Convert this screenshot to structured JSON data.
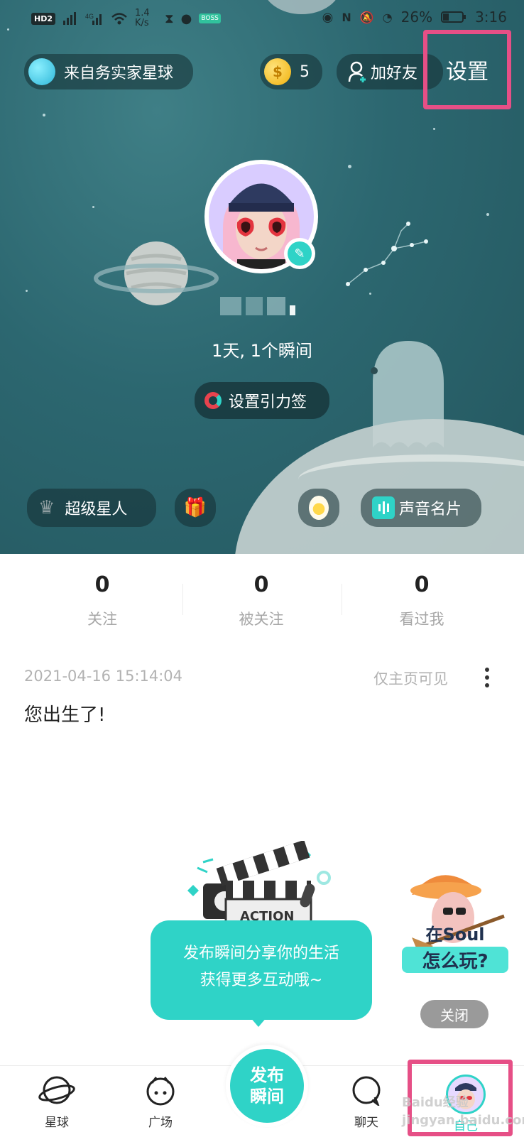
{
  "status_bar": {
    "left_badge": "HD2",
    "speed": "1.4 K/s",
    "battery": "26%",
    "time": "3:16"
  },
  "header": {
    "planet_label": "来自务实家星球",
    "coins": "5",
    "add_friend_label": "加好友",
    "settings_label": "设置"
  },
  "profile": {
    "stats_line": "1天, 1个瞬间",
    "gravity_tag_label": "设置引力签"
  },
  "actions": {
    "super_star_label": "超级星人",
    "voice_card_label": "声音名片"
  },
  "stats": [
    {
      "count": "0",
      "label": "关注"
    },
    {
      "count": "0",
      "label": "被关注"
    },
    {
      "count": "0",
      "label": "看过我"
    }
  ],
  "post": {
    "timestamp": "2021-04-16 15:14:04",
    "visibility": "仅主页可见",
    "content": "您出生了!"
  },
  "promo": {
    "action_text": "ACTION",
    "line1": "发布瞬间分享你的生活",
    "line2": "获得更多互动哦~"
  },
  "soul_guide": {
    "line1": "在Soul",
    "line2": "怎么玩?",
    "close_label": "关闭"
  },
  "tabbar": {
    "planet": "星球",
    "square": "广场",
    "publish": "发布瞬间",
    "chat": "聊天",
    "me": "自己"
  },
  "watermark": "Baidu经验 jingyan.baidu.com",
  "colors": {
    "accent": "#2fd3c7",
    "highlight": "#e64f86",
    "hero_bg": "#2c6770"
  }
}
